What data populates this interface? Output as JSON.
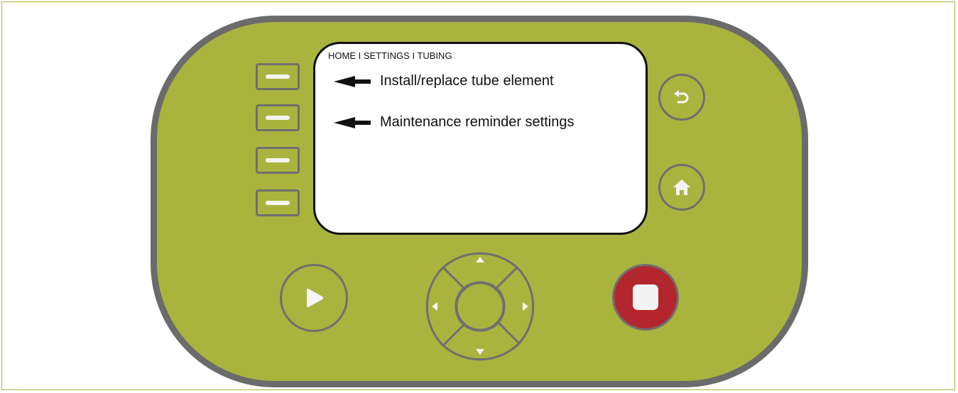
{
  "screen": {
    "breadcrumb": "HOME I SETTINGS I TUBING",
    "menu_items": [
      {
        "label": "Install/replace tube element"
      },
      {
        "label": "Maintenance reminder settings"
      }
    ]
  },
  "colors": {
    "panel": "#a9b43f",
    "bezel": "#6b6b6b",
    "stop": "#b3262e",
    "screen": "#ffffff"
  },
  "icons": {
    "back": "back-arrow-icon",
    "home": "home-icon",
    "play": "play-icon",
    "stop": "stop-icon",
    "up": "up-arrow-icon",
    "down": "down-arrow-icon",
    "left": "left-arrow-icon",
    "right": "right-arrow-icon"
  }
}
